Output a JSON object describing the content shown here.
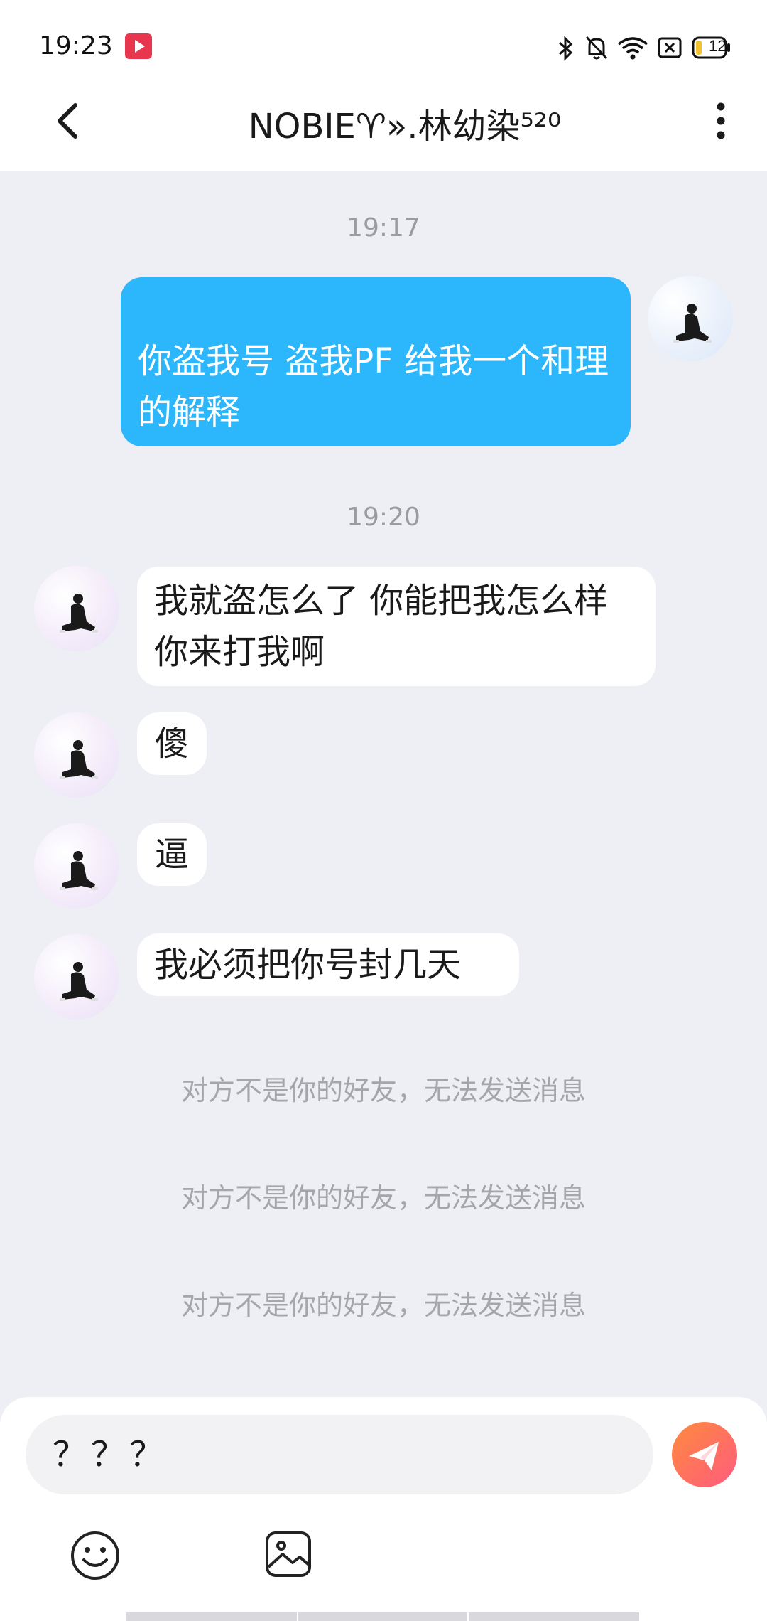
{
  "status_bar": {
    "time": "19:23",
    "battery": "12"
  },
  "header": {
    "title": "NOBIE♈︎».林幼染⁵²⁰"
  },
  "messages": [
    {
      "type": "timestamp",
      "text": "19:17"
    },
    {
      "type": "sent",
      "text": "你盗我号  盗我PF  给我一个和理的解释"
    },
    {
      "type": "timestamp",
      "text": "19:20"
    },
    {
      "type": "received",
      "text": "我就盗怎么了  你能把我怎么样  你来打我啊"
    },
    {
      "type": "received",
      "text": "傻"
    },
    {
      "type": "received",
      "text": "逼"
    },
    {
      "type": "received",
      "text": "我必须把你号封几天"
    }
  ],
  "notices": [
    "对方不是你的好友，无法发送消息",
    "对方不是你的好友，无法发送消息",
    "对方不是你的好友，无法发送消息"
  ],
  "composer": {
    "input_value": "？？？"
  },
  "colors": {
    "sent_bubble": "#2cb6fb",
    "send_button_start": "#ff8a3d",
    "send_button_end": "#ff5b7f",
    "background": "#eeeff4"
  }
}
